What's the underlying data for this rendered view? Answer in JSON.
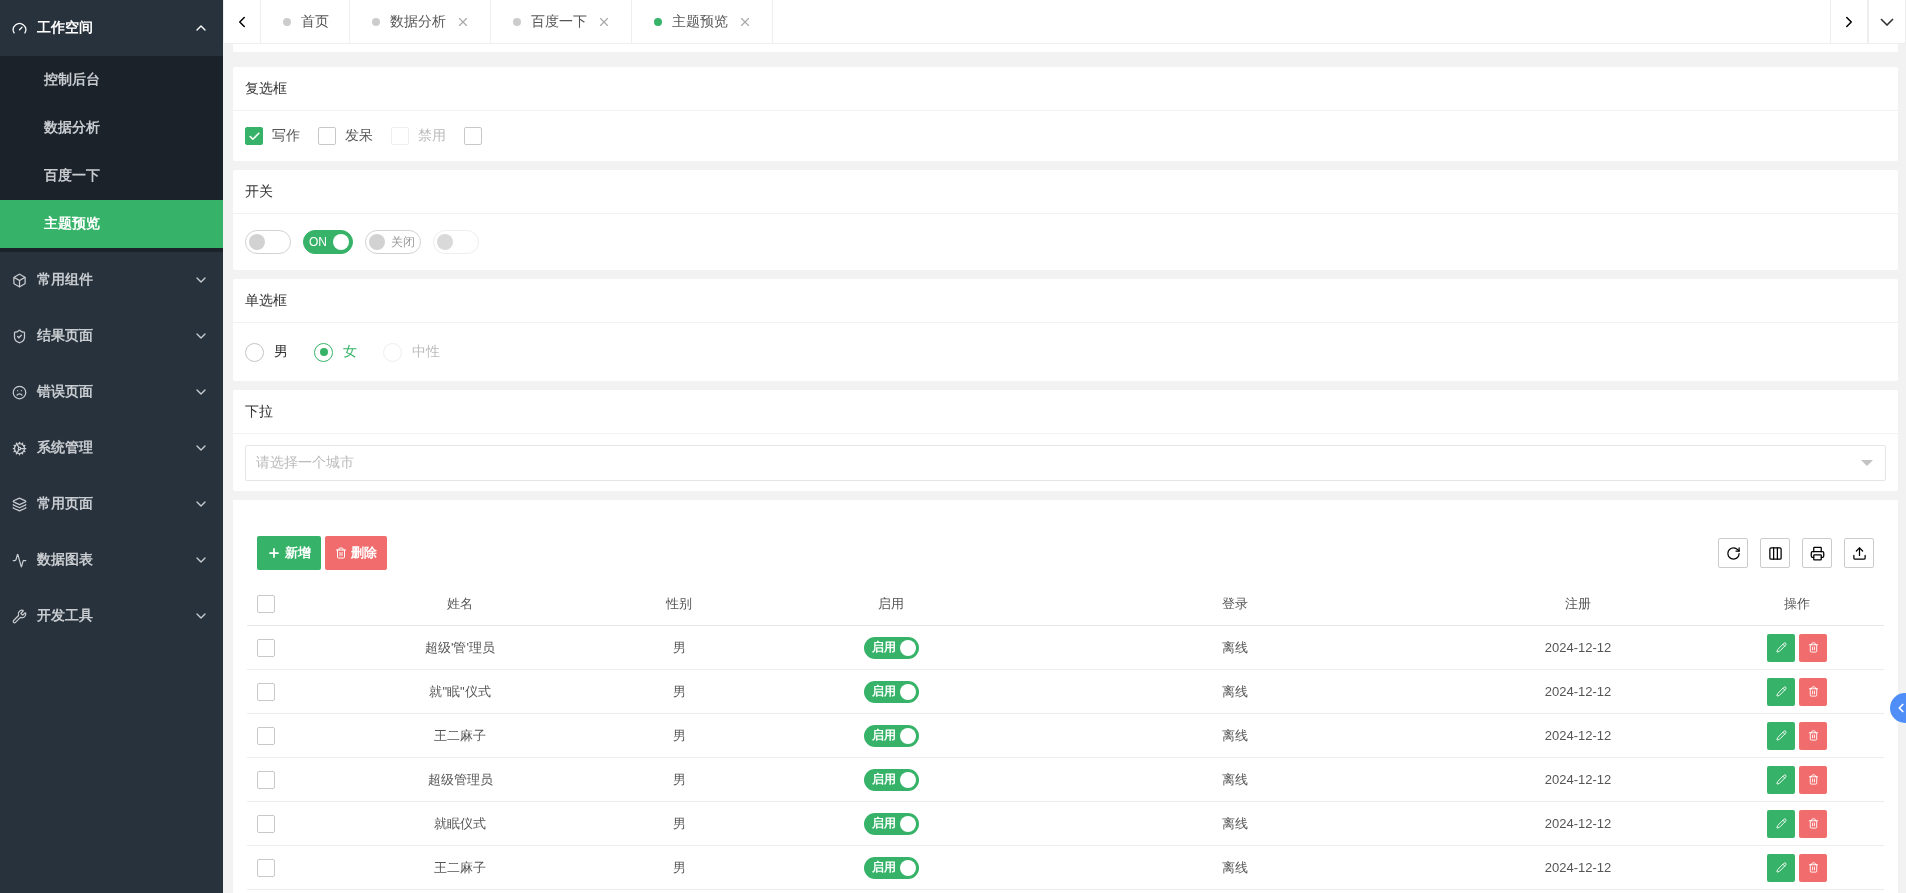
{
  "sidebar": {
    "groups": [
      {
        "label": "工作空间",
        "expanded": true,
        "children": [
          {
            "label": "控制后台",
            "selected": false
          },
          {
            "label": "数据分析",
            "selected": false
          },
          {
            "label": "百度一下",
            "selected": false
          },
          {
            "label": "主题预览",
            "selected": true
          }
        ]
      },
      {
        "label": "常用组件",
        "expanded": false
      },
      {
        "label": "结果页面",
        "expanded": false
      },
      {
        "label": "错误页面",
        "expanded": false
      },
      {
        "label": "系统管理",
        "expanded": false
      },
      {
        "label": "常用页面",
        "expanded": false
      },
      {
        "label": "数据图表",
        "expanded": false
      },
      {
        "label": "开发工具",
        "expanded": false
      }
    ]
  },
  "tabs": [
    {
      "label": "首页",
      "closable": false,
      "selected": false
    },
    {
      "label": "数据分析",
      "closable": true,
      "selected": false
    },
    {
      "label": "百度一下",
      "closable": true,
      "selected": false
    },
    {
      "label": "主题预览",
      "closable": true,
      "selected": true
    }
  ],
  "checkbox_section": {
    "title": "复选框",
    "items": [
      {
        "label": "写作",
        "checked": true,
        "disabled": false
      },
      {
        "label": "发呆",
        "checked": false,
        "disabled": false
      },
      {
        "label": "禁用",
        "checked": false,
        "disabled": true
      },
      {
        "checked": false,
        "disabled": false
      }
    ]
  },
  "switch_section": {
    "title": "开关",
    "items": [
      {
        "on": false,
        "disabled": false
      },
      {
        "on": true,
        "text": "ON",
        "disabled": false
      },
      {
        "on": false,
        "text": "关闭",
        "disabled": false
      },
      {
        "on": false,
        "disabled": true
      }
    ]
  },
  "radio_section": {
    "title": "单选框",
    "items": [
      {
        "label": "男",
        "selected": false,
        "disabled": false
      },
      {
        "label": "女",
        "selected": true,
        "disabled": false
      },
      {
        "label": "中性",
        "selected": false,
        "disabled": true
      }
    ]
  },
  "select_section": {
    "title": "下拉",
    "placeholder": "请选择一个城市"
  },
  "table": {
    "add_button": "新增",
    "delete_button": "删除",
    "header_checked": false,
    "columns": [
      "姓名",
      "性别",
      "启用",
      "登录",
      "注册",
      "操作"
    ],
    "rows": [
      {
        "checked": false,
        "name": "超级'管'理员",
        "gender": "男",
        "enabled": true,
        "enabled_label": "启用",
        "login": "离线",
        "registered": "2024-12-12"
      },
      {
        "checked": false,
        "name": "就\"眠\"仪式",
        "gender": "男",
        "enabled": true,
        "enabled_label": "启用",
        "login": "离线",
        "registered": "2024-12-12"
      },
      {
        "checked": false,
        "name": "王二麻子",
        "gender": "男",
        "enabled": true,
        "enabled_label": "启用",
        "login": "离线",
        "registered": "2024-12-12"
      },
      {
        "checked": false,
        "name": "超级管理员",
        "gender": "男",
        "enabled": true,
        "enabled_label": "启用",
        "login": "离线",
        "registered": "2024-12-12"
      },
      {
        "checked": false,
        "name": "就眠仪式",
        "gender": "男",
        "enabled": true,
        "enabled_label": "启用",
        "login": "离线",
        "registered": "2024-12-12"
      },
      {
        "checked": false,
        "name": "王二麻子",
        "gender": "男",
        "enabled": true,
        "enabled_label": "启用",
        "login": "离线",
        "registered": "2024-12-12"
      }
    ]
  }
}
